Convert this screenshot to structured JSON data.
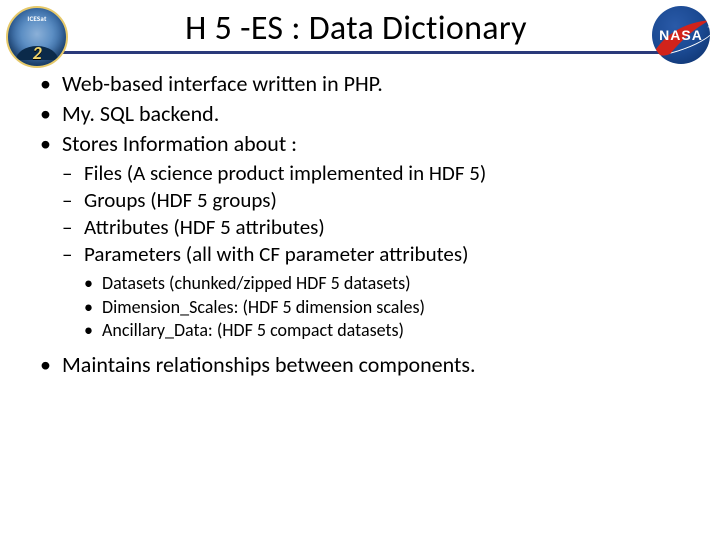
{
  "title": "H 5 -ES : Data Dictionary",
  "logos": {
    "icesat": {
      "label": "ICESat",
      "num": "2"
    },
    "nasa": {
      "text": "NASA"
    }
  },
  "bullets": [
    "Web-based interface written in PHP.",
    "My. SQL backend.",
    "Stores Information about :"
  ],
  "dashes": [
    "Files (A science product implemented in HDF 5)",
    "Groups (HDF 5 groups)",
    "Attributes (HDF 5 attributes)",
    "Parameters (all with CF parameter attributes)"
  ],
  "subbullets": [
    "Datasets (chunked/zipped HDF 5 datasets)",
    "Dimension_Scales: (HDF 5 dimension scales)",
    "Ancillary_Data: (HDF 5 compact datasets)"
  ],
  "last_bullet": "Maintains relationships between components."
}
